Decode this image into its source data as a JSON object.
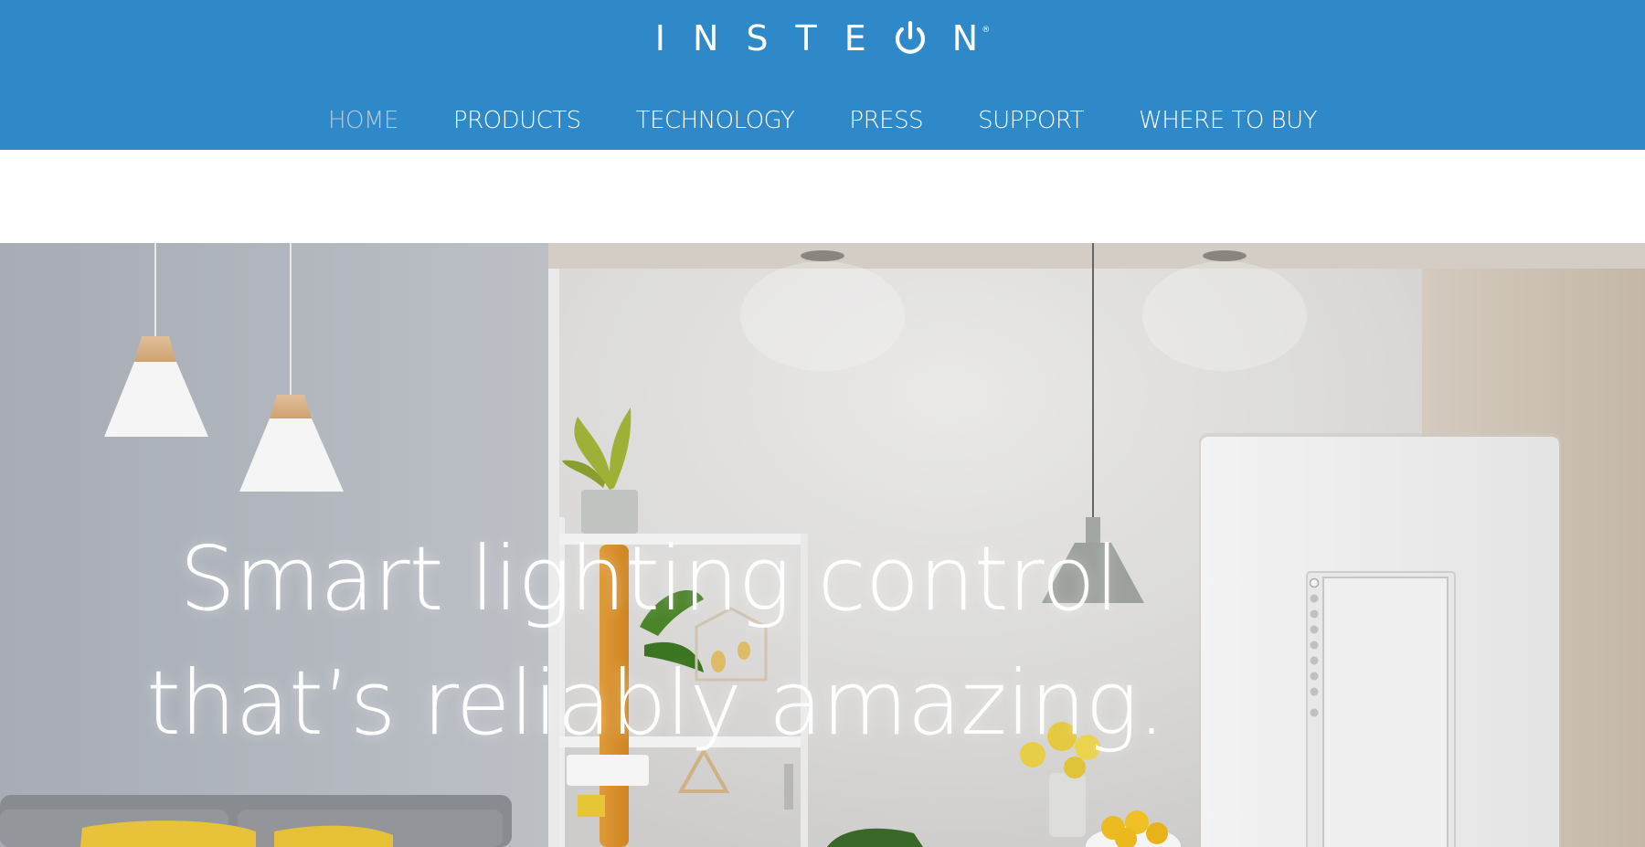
{
  "brand": {
    "logo_text": "INSTEON",
    "registered_mark": "®",
    "accent_color": "#2f89c8"
  },
  "nav": {
    "items": [
      {
        "label": "HOME",
        "active": true
      },
      {
        "label": "PRODUCTS",
        "active": false
      },
      {
        "label": "TECHNOLOGY",
        "active": false
      },
      {
        "label": "PRESS",
        "active": false
      },
      {
        "label": "SUPPORT",
        "active": false
      },
      {
        "label": "WHERE TO BUY",
        "active": false
      }
    ]
  },
  "hero": {
    "headline_line1": "Smart lighting control",
    "headline_line2": "that’s reliably amazing.",
    "image_description_icon": "smart-dimmer-switch-room-photo"
  }
}
